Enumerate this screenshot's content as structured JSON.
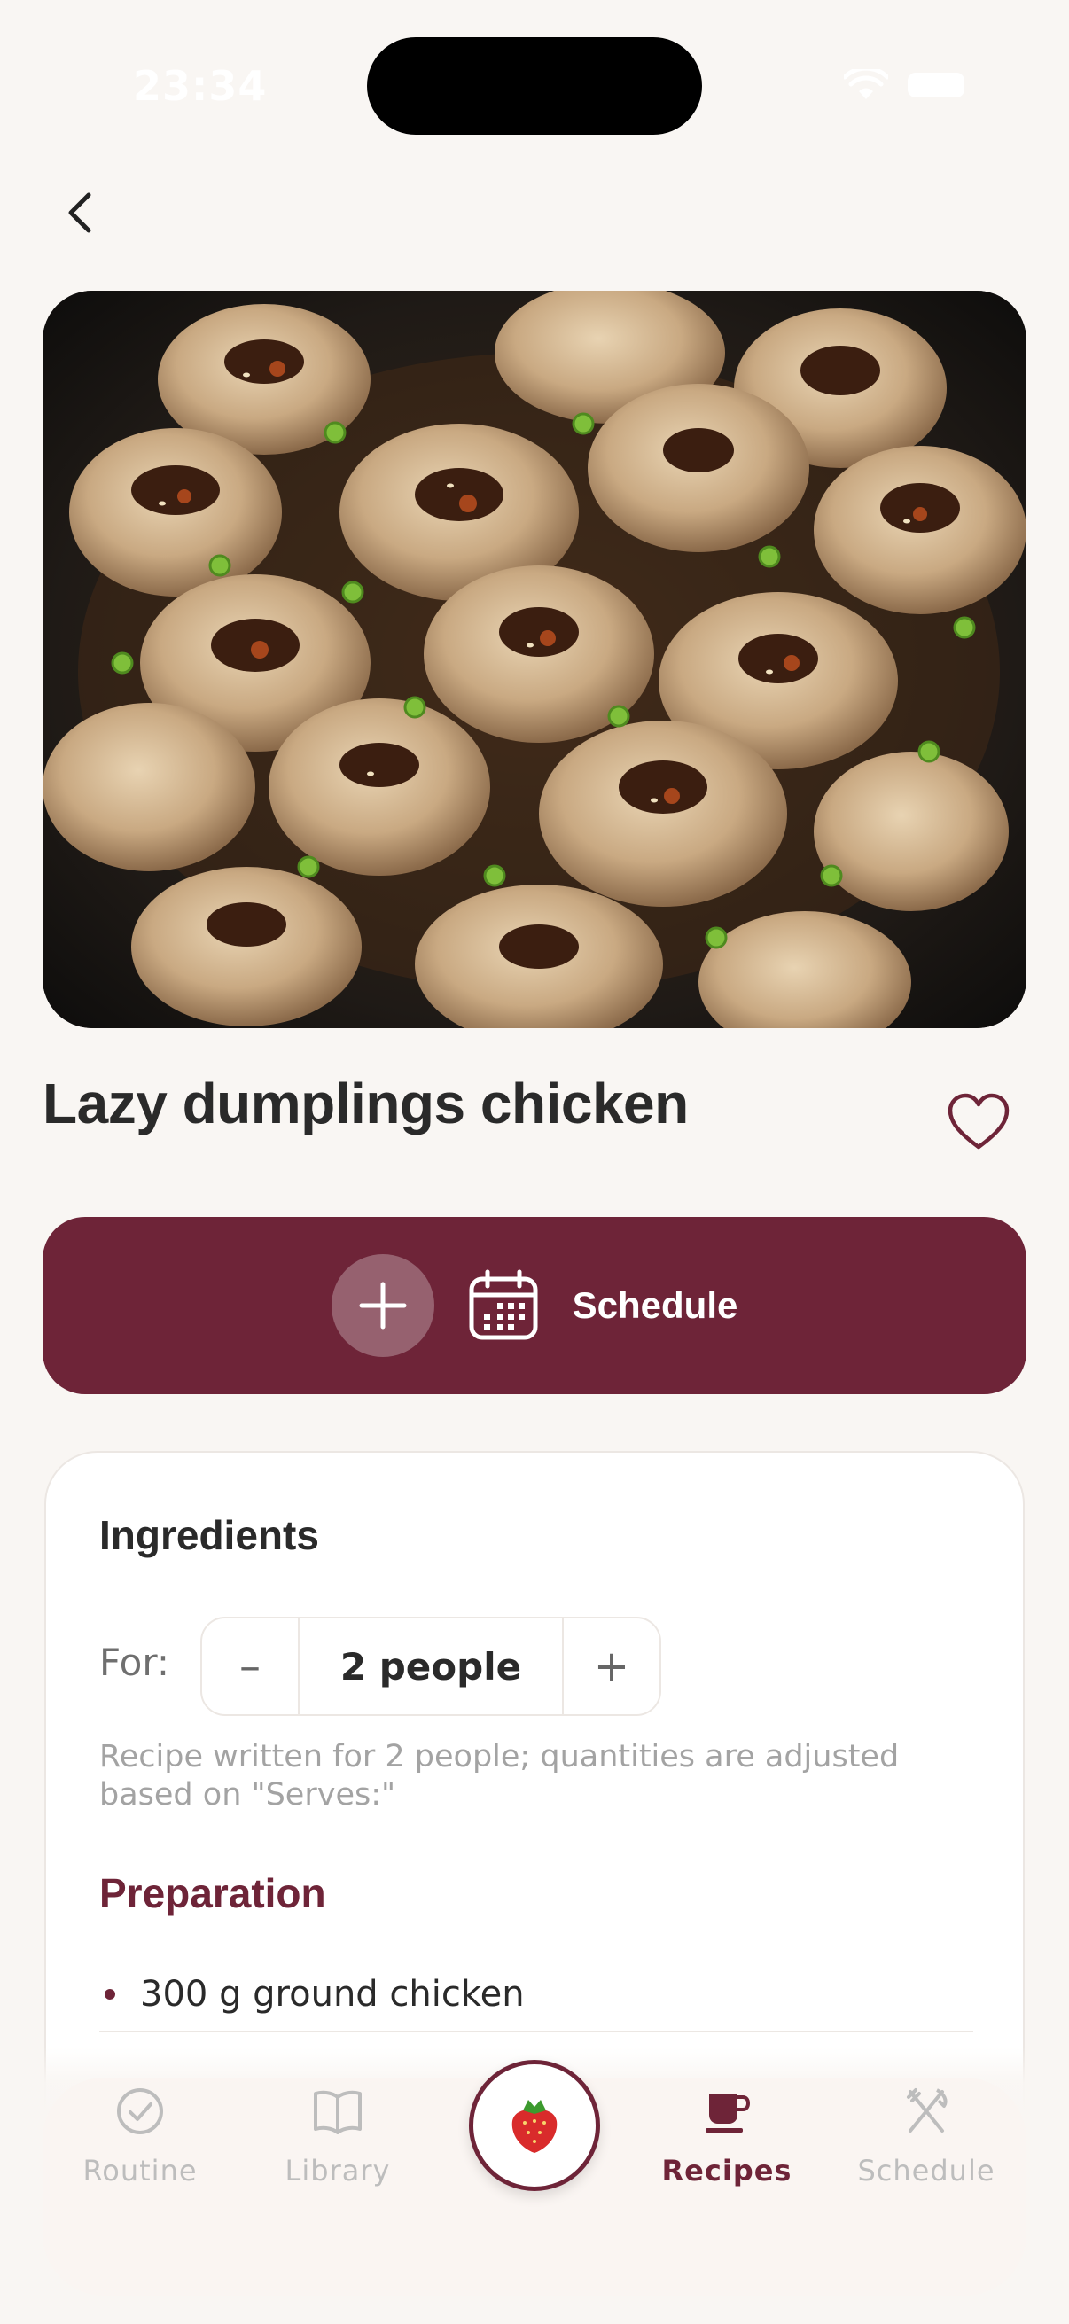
{
  "status_bar": {
    "time": "23:34"
  },
  "recipe": {
    "title": "Lazy dumplings chicken",
    "image_alt": "Chicken dumplings in chili oil"
  },
  "schedule_button": {
    "label": "Schedule"
  },
  "ingredients_card": {
    "title": "Ingredients",
    "for_label": "For:",
    "servings_value": "2 people",
    "minus_label": "–",
    "plus_label": "+",
    "note": "Recipe written for 2 people; quantities are adjusted based on \"Serves:\"",
    "section_title": "Preparation",
    "items": [
      "300 g ground chicken"
    ]
  },
  "bottom_nav": {
    "items": [
      {
        "label": "Routine",
        "icon": "check-circle-icon",
        "active": false
      },
      {
        "label": "Library",
        "icon": "book-icon",
        "active": false
      },
      {
        "label": "Recipes",
        "icon": "cup-icon",
        "active": true
      },
      {
        "label": "Schedule",
        "icon": "fork-knife-icon",
        "active": false
      }
    ],
    "center_icon": "strawberry-icon"
  },
  "colors": {
    "accent": "#6e2438",
    "background": "#f9f6f3",
    "inactive": "#bdbdbd"
  }
}
